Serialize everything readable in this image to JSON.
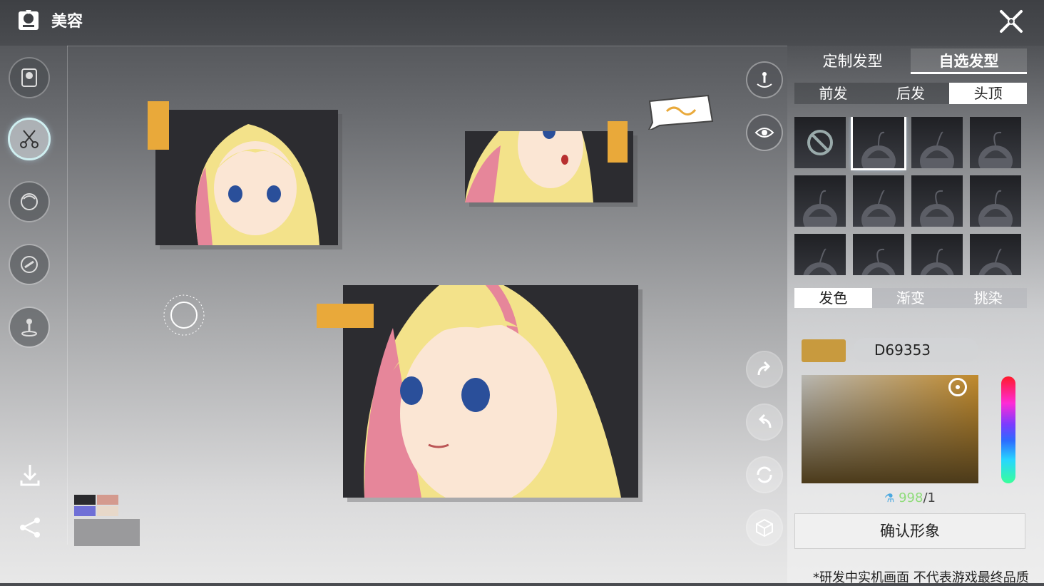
{
  "header": {
    "title": "美容"
  },
  "customize_tabs": [
    {
      "label": "定制发型",
      "active": false
    },
    {
      "label": "自选发型",
      "active": true
    }
  ],
  "part_tabs": [
    {
      "label": "前发",
      "active": false
    },
    {
      "label": "后发",
      "active": false
    },
    {
      "label": "头顶",
      "active": true
    }
  ],
  "hair_options": [
    {
      "name": "none-option-icon",
      "selected": false
    },
    {
      "name": "hair-style-icon",
      "selected": true
    },
    {
      "name": "hair-style-icon",
      "selected": false
    },
    {
      "name": "hair-style-icon",
      "selected": false
    },
    {
      "name": "hair-style-icon",
      "selected": false
    },
    {
      "name": "hair-style-icon",
      "selected": false
    },
    {
      "name": "hair-style-icon",
      "selected": false
    },
    {
      "name": "hair-style-icon",
      "selected": false
    },
    {
      "name": "hair-style-icon",
      "selected": false
    },
    {
      "name": "hair-style-icon",
      "selected": false
    },
    {
      "name": "hair-style-icon",
      "selected": false
    },
    {
      "name": "hair-style-icon",
      "selected": false
    }
  ],
  "color_tabs": [
    {
      "label": "发色",
      "active": true
    },
    {
      "label": "渐变",
      "active": false
    },
    {
      "label": "挑染",
      "active": false
    }
  ],
  "color": {
    "hex": "D69353",
    "swatch": "#C89A3E"
  },
  "cost": {
    "amount": "998",
    "separator": "/",
    "total": "1"
  },
  "confirm_label": "确认形象",
  "disclaimer": "*研发中实机画面 不代表游戏最终品质",
  "colors": {
    "accent": "#E9A93A",
    "selection": "#CFEFF0"
  }
}
